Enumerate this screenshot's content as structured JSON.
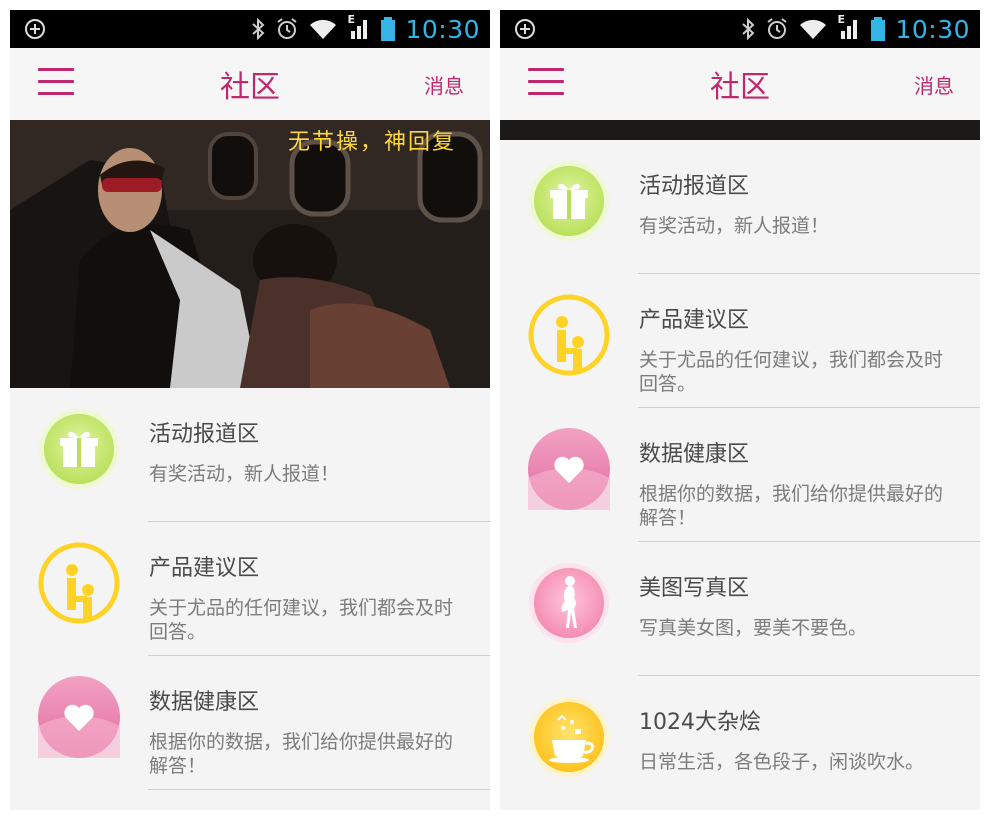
{
  "status_bar": {
    "time": "10:30",
    "network": "E"
  },
  "screens": [
    {
      "header": {
        "title": "社区",
        "message_label": "消息"
      },
      "banner": {
        "slogan": "无节操，神回复"
      },
      "sections": [
        {
          "name": "活动报道区",
          "description": "有奖活动，新人报道！",
          "icon": "gift-icon"
        },
        {
          "name": "产品建议区",
          "description": "关于尤品的任何建议，我们都会及时回答。",
          "icon": "person-logo-icon"
        },
        {
          "name": "数据健康区",
          "description": "根据你的数据，我们给你提供最好的解答！",
          "icon": "heart-icon"
        }
      ]
    },
    {
      "header": {
        "title": "社区",
        "message_label": "消息"
      },
      "sections": [
        {
          "name": "活动报道区",
          "description": "有奖活动，新人报道！",
          "icon": "gift-icon"
        },
        {
          "name": "产品建议区",
          "description": "关于尤品的任何建议，我们都会及时回答。",
          "icon": "person-logo-icon"
        },
        {
          "name": "数据健康区",
          "description": "根据你的数据，我们给你提供最好的解答！",
          "icon": "heart-icon"
        },
        {
          "name": "美图写真区",
          "description": "写真美女图，要美不要色。",
          "icon": "woman-silhouette-icon"
        },
        {
          "name": "1024大杂烩",
          "description": "日常生活，各色段子，闲谈吹水。",
          "icon": "teacup-icon"
        }
      ]
    }
  ],
  "colors": {
    "accent": "#c0286d",
    "status_time": "#33b5e5",
    "slogan": "#ffd83a",
    "background": "#f4f4f4"
  }
}
